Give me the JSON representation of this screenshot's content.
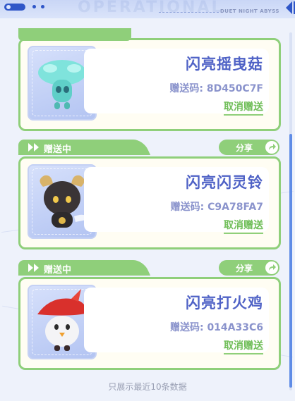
{
  "header": {
    "watermark": "OPERATIONAL",
    "brand": "DUET NIGHT ABYSS"
  },
  "status_label": "赠送中",
  "share_label": "分享",
  "cards": [
    {
      "name": "闪亮摇曳菇",
      "code": "赠送码: 8D450C7F",
      "cancel": "取消赠送",
      "icon": "mushroom-pet-icon"
    },
    {
      "name": "闪亮闪灵铃",
      "code": "赠送码: C9A78FA7",
      "cancel": "取消赠送",
      "icon": "ram-pet-icon"
    },
    {
      "name": "闪亮打火鸡",
      "code": "赠送码: 014A33C6",
      "cancel": "取消赠送",
      "icon": "chick-pet-icon"
    }
  ],
  "footer": "只展示最近10条数据",
  "colors": {
    "accent_green": "#8fcf7a",
    "title_blue": "#4f62c6",
    "code_purple": "#8a93cc",
    "background": "#eef2fb"
  }
}
